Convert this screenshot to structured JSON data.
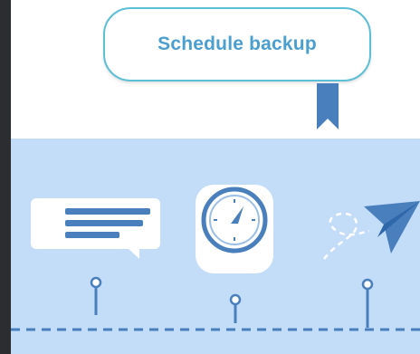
{
  "banner": {
    "label": "Schedule backup"
  },
  "icons": [
    "message-bubble-icon",
    "stopwatch-icon",
    "paper-plane-icon"
  ],
  "colors": {
    "frame": "#2b2d31",
    "panel": "#c3dcf8",
    "accent": "#4a7fbd",
    "pill_border": "#5bbfd6",
    "pill_text": "#4a9fd0"
  }
}
